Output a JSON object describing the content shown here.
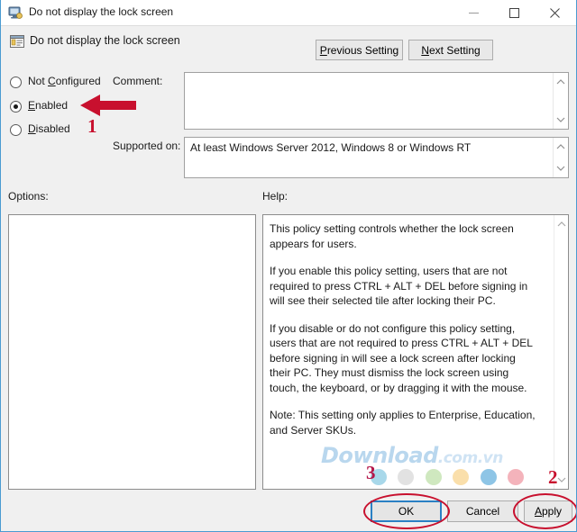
{
  "window": {
    "title": "Do not display the lock screen",
    "icon": "monitor-policy-icon",
    "minimize_label": "Minimize",
    "maximize_label": "Maximize",
    "close_label": "Close"
  },
  "header": {
    "title": "Do not display the lock screen",
    "icon": "policy-setting-icon",
    "previous_setting": "Previous Setting",
    "previous_accel": "P",
    "next_setting": "Next Setting",
    "next_accel": "N"
  },
  "state": {
    "options": [
      {
        "label": "Not Configured",
        "accel": "C",
        "selected": false
      },
      {
        "label": "Enabled",
        "accel": "E",
        "selected": true
      },
      {
        "label": "Disabled",
        "accel": "D",
        "selected": false
      }
    ]
  },
  "fields": {
    "comment_label": "Comment:",
    "comment_value": "",
    "supported_label": "Supported on:",
    "supported_value": "At least Windows Server 2012, Windows 8 or Windows RT"
  },
  "panes": {
    "options_label": "Options:",
    "options_value": "",
    "help_label": "Help:",
    "help_paragraphs": [
      "This policy setting controls whether the lock screen appears for users.",
      "If you enable this policy setting, users that are not required to press CTRL + ALT + DEL before signing in will see their selected tile after locking their PC.",
      "If you disable or do not configure this policy setting, users that are not required to press CTRL + ALT + DEL before signing in will see a lock screen after locking their PC. They must dismiss the lock screen using touch, the keyboard, or by dragging it with the mouse.",
      "Note: This setting only applies to Enterprise, Education, and Server SKUs."
    ]
  },
  "footer": {
    "ok": "OK",
    "cancel": "Cancel",
    "apply": "Apply",
    "apply_accel": "A"
  },
  "watermark": {
    "main": "Download",
    "suffix": ".com.vn",
    "dot_colors": [
      "#a8d8ea",
      "#e2e2e2",
      "#cfe8bf",
      "#fadfab",
      "#8ec5e6",
      "#f4b3bb"
    ]
  },
  "annotations": {
    "one": "1",
    "two": "2",
    "three": "3",
    "arrow_color": "#c8102e",
    "ellipse_color": "#c8102e"
  }
}
